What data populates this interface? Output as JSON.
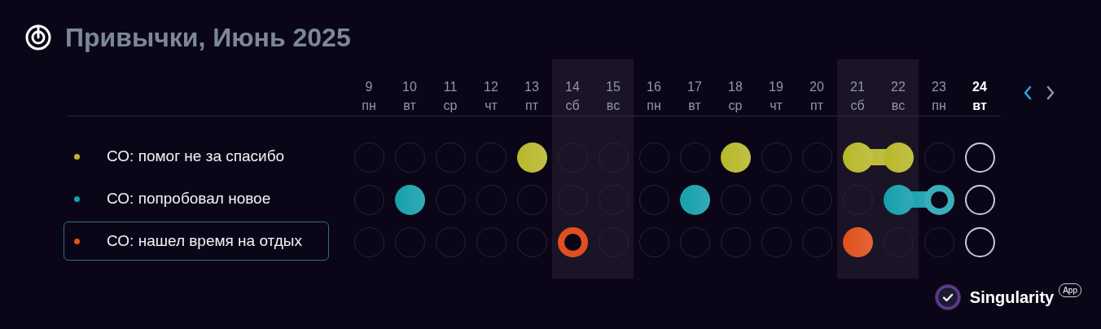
{
  "header": {
    "title": "Привычки, **Июнь** 2025"
  },
  "days": [
    {
      "number": "9",
      "weekday": "пн",
      "weekend": false,
      "today": false
    },
    {
      "number": "10",
      "weekday": "вт",
      "weekend": false,
      "today": false
    },
    {
      "number": "11",
      "weekday": "ср",
      "weekend": false,
      "today": false
    },
    {
      "number": "12",
      "weekday": "чт",
      "weekend": false,
      "today": false
    },
    {
      "number": "13",
      "weekday": "пт",
      "weekend": false,
      "today": false
    },
    {
      "number": "14",
      "weekday": "сб",
      "weekend": true,
      "today": false
    },
    {
      "number": "15",
      "weekday": "вс",
      "weekend": true,
      "today": false
    },
    {
      "number": "16",
      "weekday": "пн",
      "weekend": false,
      "today": false
    },
    {
      "number": "17",
      "weekday": "вт",
      "weekend": false,
      "today": false
    },
    {
      "number": "18",
      "weekday": "ср",
      "weekend": false,
      "today": false
    },
    {
      "number": "19",
      "weekday": "чт",
      "weekend": false,
      "today": false
    },
    {
      "number": "20",
      "weekday": "пт",
      "weekend": false,
      "today": false
    },
    {
      "number": "21",
      "weekday": "сб",
      "weekend": true,
      "today": false
    },
    {
      "number": "22",
      "weekday": "вс",
      "weekend": true,
      "today": false
    },
    {
      "number": "23",
      "weekday": "пн",
      "weekend": false,
      "today": false
    },
    {
      "number": "24",
      "weekday": "вт",
      "weekend": false,
      "today": true
    }
  ],
  "nav": {
    "prev_enabled": true,
    "next_enabled": false
  },
  "habits": [
    {
      "name": "СО: помог не за спасибо",
      "color": "#b8b82c",
      "selected": false,
      "marks": [
        {
          "done": false,
          "partial": false
        },
        {
          "done": false,
          "partial": false
        },
        {
          "done": false,
          "partial": false
        },
        {
          "done": false,
          "partial": false
        },
        {
          "done": true,
          "partial": false
        },
        {
          "done": false,
          "partial": false
        },
        {
          "done": false,
          "partial": false
        },
        {
          "done": false,
          "partial": false
        },
        {
          "done": false,
          "partial": false
        },
        {
          "done": true,
          "partial": false
        },
        {
          "done": false,
          "partial": false
        },
        {
          "done": false,
          "partial": false
        },
        {
          "done": true,
          "partial": false
        },
        {
          "done": true,
          "partial": false
        },
        {
          "done": false,
          "partial": false
        },
        {
          "done": false,
          "partial": false
        }
      ]
    },
    {
      "name": "СО: попробовал новое",
      "color": "#16a0ac",
      "selected": false,
      "marks": [
        {
          "done": false,
          "partial": false
        },
        {
          "done": true,
          "partial": false
        },
        {
          "done": false,
          "partial": false
        },
        {
          "done": false,
          "partial": false
        },
        {
          "done": false,
          "partial": false
        },
        {
          "done": false,
          "partial": false
        },
        {
          "done": false,
          "partial": false
        },
        {
          "done": false,
          "partial": false
        },
        {
          "done": true,
          "partial": false
        },
        {
          "done": false,
          "partial": false
        },
        {
          "done": false,
          "partial": false
        },
        {
          "done": false,
          "partial": false
        },
        {
          "done": false,
          "partial": false
        },
        {
          "done": true,
          "partial": false
        },
        {
          "done": false,
          "partial": true
        },
        {
          "done": false,
          "partial": false
        }
      ]
    },
    {
      "name": "СО: нашел время на отдых",
      "color": "#e0501c",
      "selected": true,
      "marks": [
        {
          "done": false,
          "partial": false
        },
        {
          "done": false,
          "partial": false
        },
        {
          "done": false,
          "partial": false
        },
        {
          "done": false,
          "partial": false
        },
        {
          "done": false,
          "partial": false
        },
        {
          "done": false,
          "partial": true
        },
        {
          "done": false,
          "partial": false
        },
        {
          "done": false,
          "partial": false
        },
        {
          "done": false,
          "partial": false
        },
        {
          "done": false,
          "partial": false
        },
        {
          "done": false,
          "partial": false
        },
        {
          "done": false,
          "partial": false
        },
        {
          "done": true,
          "partial": false
        },
        {
          "done": false,
          "partial": false
        },
        {
          "done": false,
          "partial": false
        },
        {
          "done": false,
          "partial": false
        }
      ]
    }
  ],
  "brand": {
    "name": "Singularity",
    "tag": "App"
  }
}
